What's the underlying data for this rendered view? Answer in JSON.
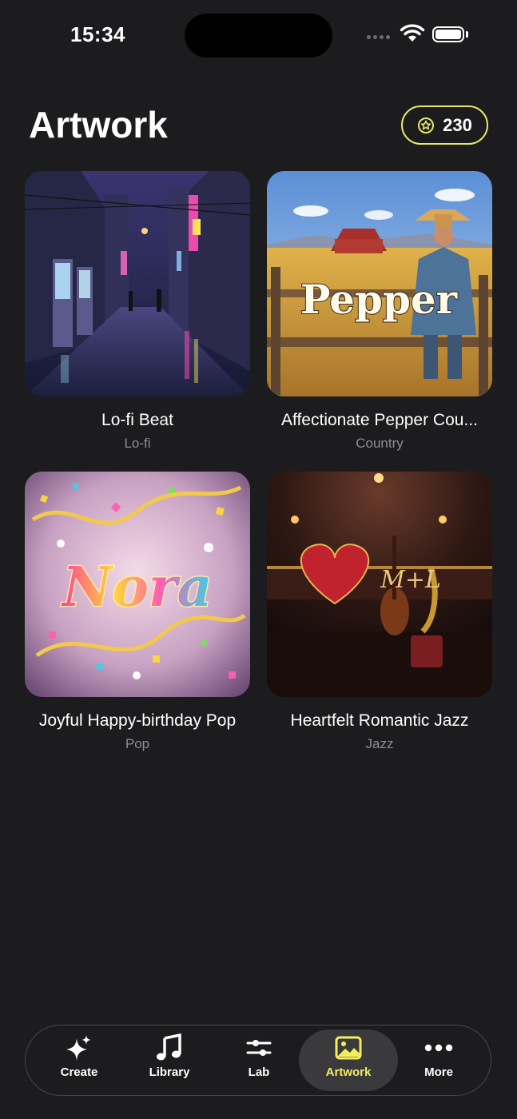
{
  "status_bar": {
    "time": "15:34"
  },
  "header": {
    "title": "Artwork",
    "credits": "230"
  },
  "artworks": [
    {
      "title": "Lo-fi Beat",
      "genre": "Lo-fi"
    },
    {
      "title": "Affectionate Pepper Cou...",
      "genre": "Country",
      "art_text": "Pepper"
    },
    {
      "title": "Joyful Happy-birthday Pop",
      "genre": "Pop",
      "art_text": "Nora"
    },
    {
      "title": "Heartfelt Romantic Jazz",
      "genre": "Jazz",
      "art_text": "M+L"
    }
  ],
  "tabs": [
    {
      "label": "Create",
      "icon": "sparkles-icon"
    },
    {
      "label": "Library",
      "icon": "music-note-icon"
    },
    {
      "label": "Lab",
      "icon": "sliders-icon"
    },
    {
      "label": "Artwork",
      "icon": "image-icon",
      "active": true
    },
    {
      "label": "More",
      "icon": "ellipsis-icon"
    }
  ],
  "colors": {
    "accent": "#f3ee5e",
    "background": "#1c1c1e",
    "secondary_text": "#8e8e93"
  }
}
